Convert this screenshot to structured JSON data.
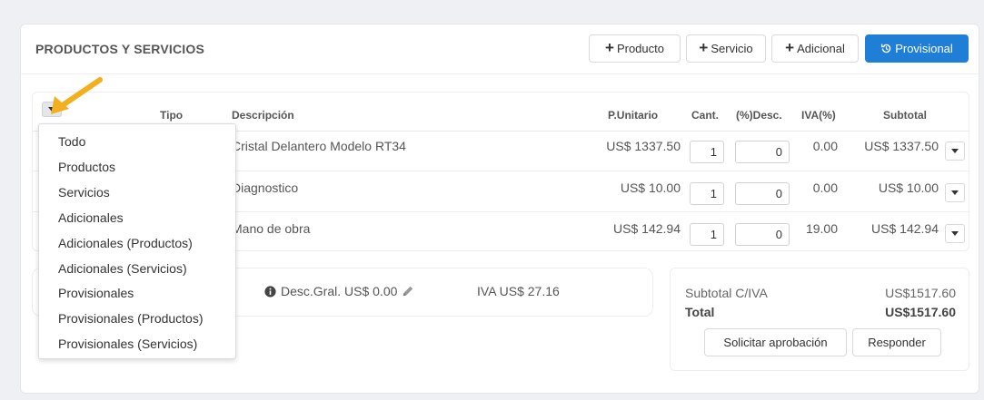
{
  "section": {
    "title": "PRODUCTOS Y SERVICIOS"
  },
  "toolbar": {
    "add_product": "Producto",
    "add_service": "Servicio",
    "add_additional": "Adicional",
    "provisional": "Provisional",
    "plus_icon": "+",
    "provisional_icon": "history-icon",
    "accent_color": "#1f7fd6"
  },
  "table": {
    "columns": {
      "tipo": "Tipo",
      "descripcion": "Descripción",
      "unit_price": "P.Unitario",
      "qty": "Cant.",
      "discount": "(%)Desc.",
      "iva": "IVA(%)",
      "subtotal": "Subtotal"
    },
    "rows": [
      {
        "description": "Cristal Delantero Modelo RT34",
        "unit_price": "US$ 1337.50",
        "qty": "1",
        "discount": "0",
        "iva": "0.00",
        "subtotal": "US$ 1337.50"
      },
      {
        "description": "Diagnostico",
        "unit_price": "US$ 10.00",
        "qty": "1",
        "discount": "0",
        "iva": "0.00",
        "subtotal": "US$ 10.00"
      },
      {
        "description": "Mano de obra",
        "unit_price": "US$ 142.94",
        "qty": "1",
        "discount": "0",
        "iva": "19.00",
        "subtotal": "US$ 142.94"
      }
    ]
  },
  "filter_menu": {
    "items": [
      "Todo",
      "Productos",
      "Servicios",
      "Adicionales",
      "Adicionales (Productos)",
      "Adicionales (Servicios)",
      "Provisionales",
      "Provisionales (Productos)",
      "Provisionales (Servicios)"
    ]
  },
  "summary": {
    "desc_gral": "Desc.Gral. US$ 0.00",
    "iva_total": "IVA US$ 27.16"
  },
  "totals": {
    "subtotal_label": "Subtotal C/IVA",
    "subtotal_value": "US$1517.60",
    "total_label": "Total",
    "total_value": "US$1517.60",
    "request_approval": "Solicitar aprobación",
    "respond": "Responder"
  }
}
